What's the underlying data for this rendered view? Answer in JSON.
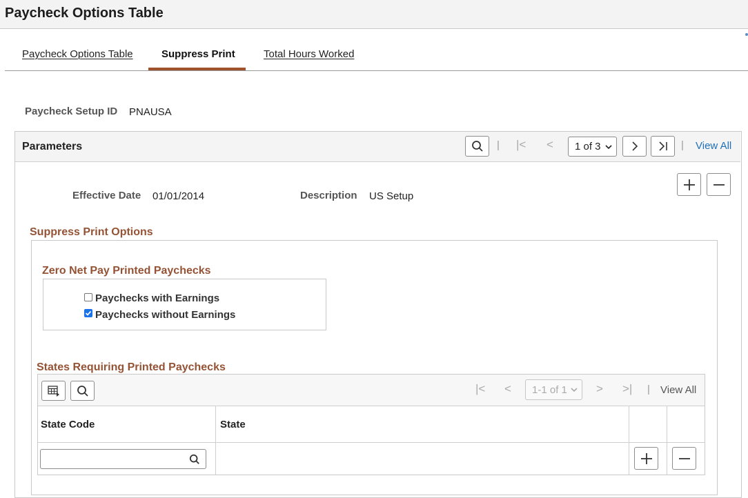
{
  "header": {
    "title": "Paycheck Options Table"
  },
  "tabs": [
    {
      "label": "Paycheck Options Table",
      "active": false
    },
    {
      "label": "Suppress Print",
      "active": true
    },
    {
      "label": "Total Hours Worked",
      "active": false
    }
  ],
  "setup": {
    "label": "Paycheck Setup ID",
    "value": "PNAUSA"
  },
  "parameters": {
    "title": "Parameters",
    "pager": "1 of 3",
    "view_all": "View All",
    "effective_date_label": "Effective Date",
    "effective_date": "01/01/2014",
    "description_label": "Description",
    "description": "US Setup"
  },
  "suppress": {
    "title": "Suppress Print Options",
    "zero_net_title": "Zero Net Pay Printed Paychecks",
    "options": [
      {
        "label": "Paychecks with Earnings",
        "checked": false
      },
      {
        "label": "Paychecks without Earnings",
        "checked": true
      }
    ]
  },
  "states": {
    "title": "States Requiring Printed Paychecks",
    "pager": "1-1 of 1",
    "view_all": "View All",
    "columns": [
      "State Code",
      "State"
    ],
    "rows": [
      {
        "state_code": "",
        "state": ""
      }
    ]
  },
  "colors": {
    "accent": "#955335",
    "tab_underline": "#a0522d",
    "link": "#1f6fb4",
    "checkbox": "#1a73e8"
  }
}
